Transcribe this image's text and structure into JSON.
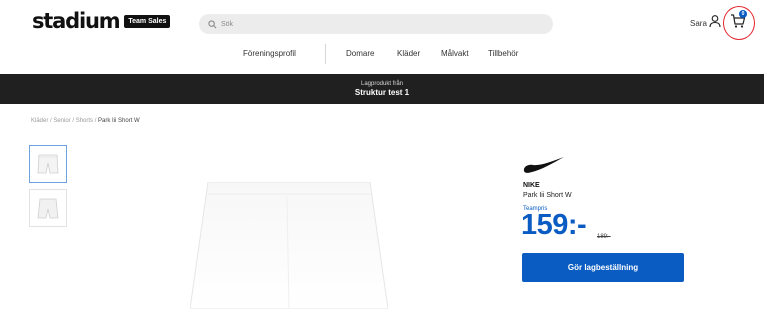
{
  "header": {
    "logo_text": "stadium",
    "logo_badge": "Team Sales",
    "search_placeholder": "Sök",
    "user_name": "Sara",
    "cart_count": "0"
  },
  "nav": {
    "items": [
      "Föreningsprofil",
      "Domare",
      "Kläder",
      "Målvakt",
      "Tillbehör"
    ]
  },
  "banner": {
    "subtitle": "Lagprodukt från",
    "title": "Struktur test 1"
  },
  "breadcrumb": {
    "path": "Kläder / Senior / Shorts / ",
    "current": "Park Iii Short W"
  },
  "product": {
    "brand": "NIKE",
    "name": "Park Iii Short W",
    "price_label": "Teampris",
    "price": "159:-",
    "old_price": "189:-",
    "cta_label": "Gör lagbeställning"
  },
  "colors": {
    "accent": "#0a5cc2",
    "banner_bg": "#202020",
    "highlight": "#e3242b"
  },
  "icons": [
    "search-icon",
    "user-icon",
    "cart-icon",
    "nike-swoosh-icon"
  ]
}
